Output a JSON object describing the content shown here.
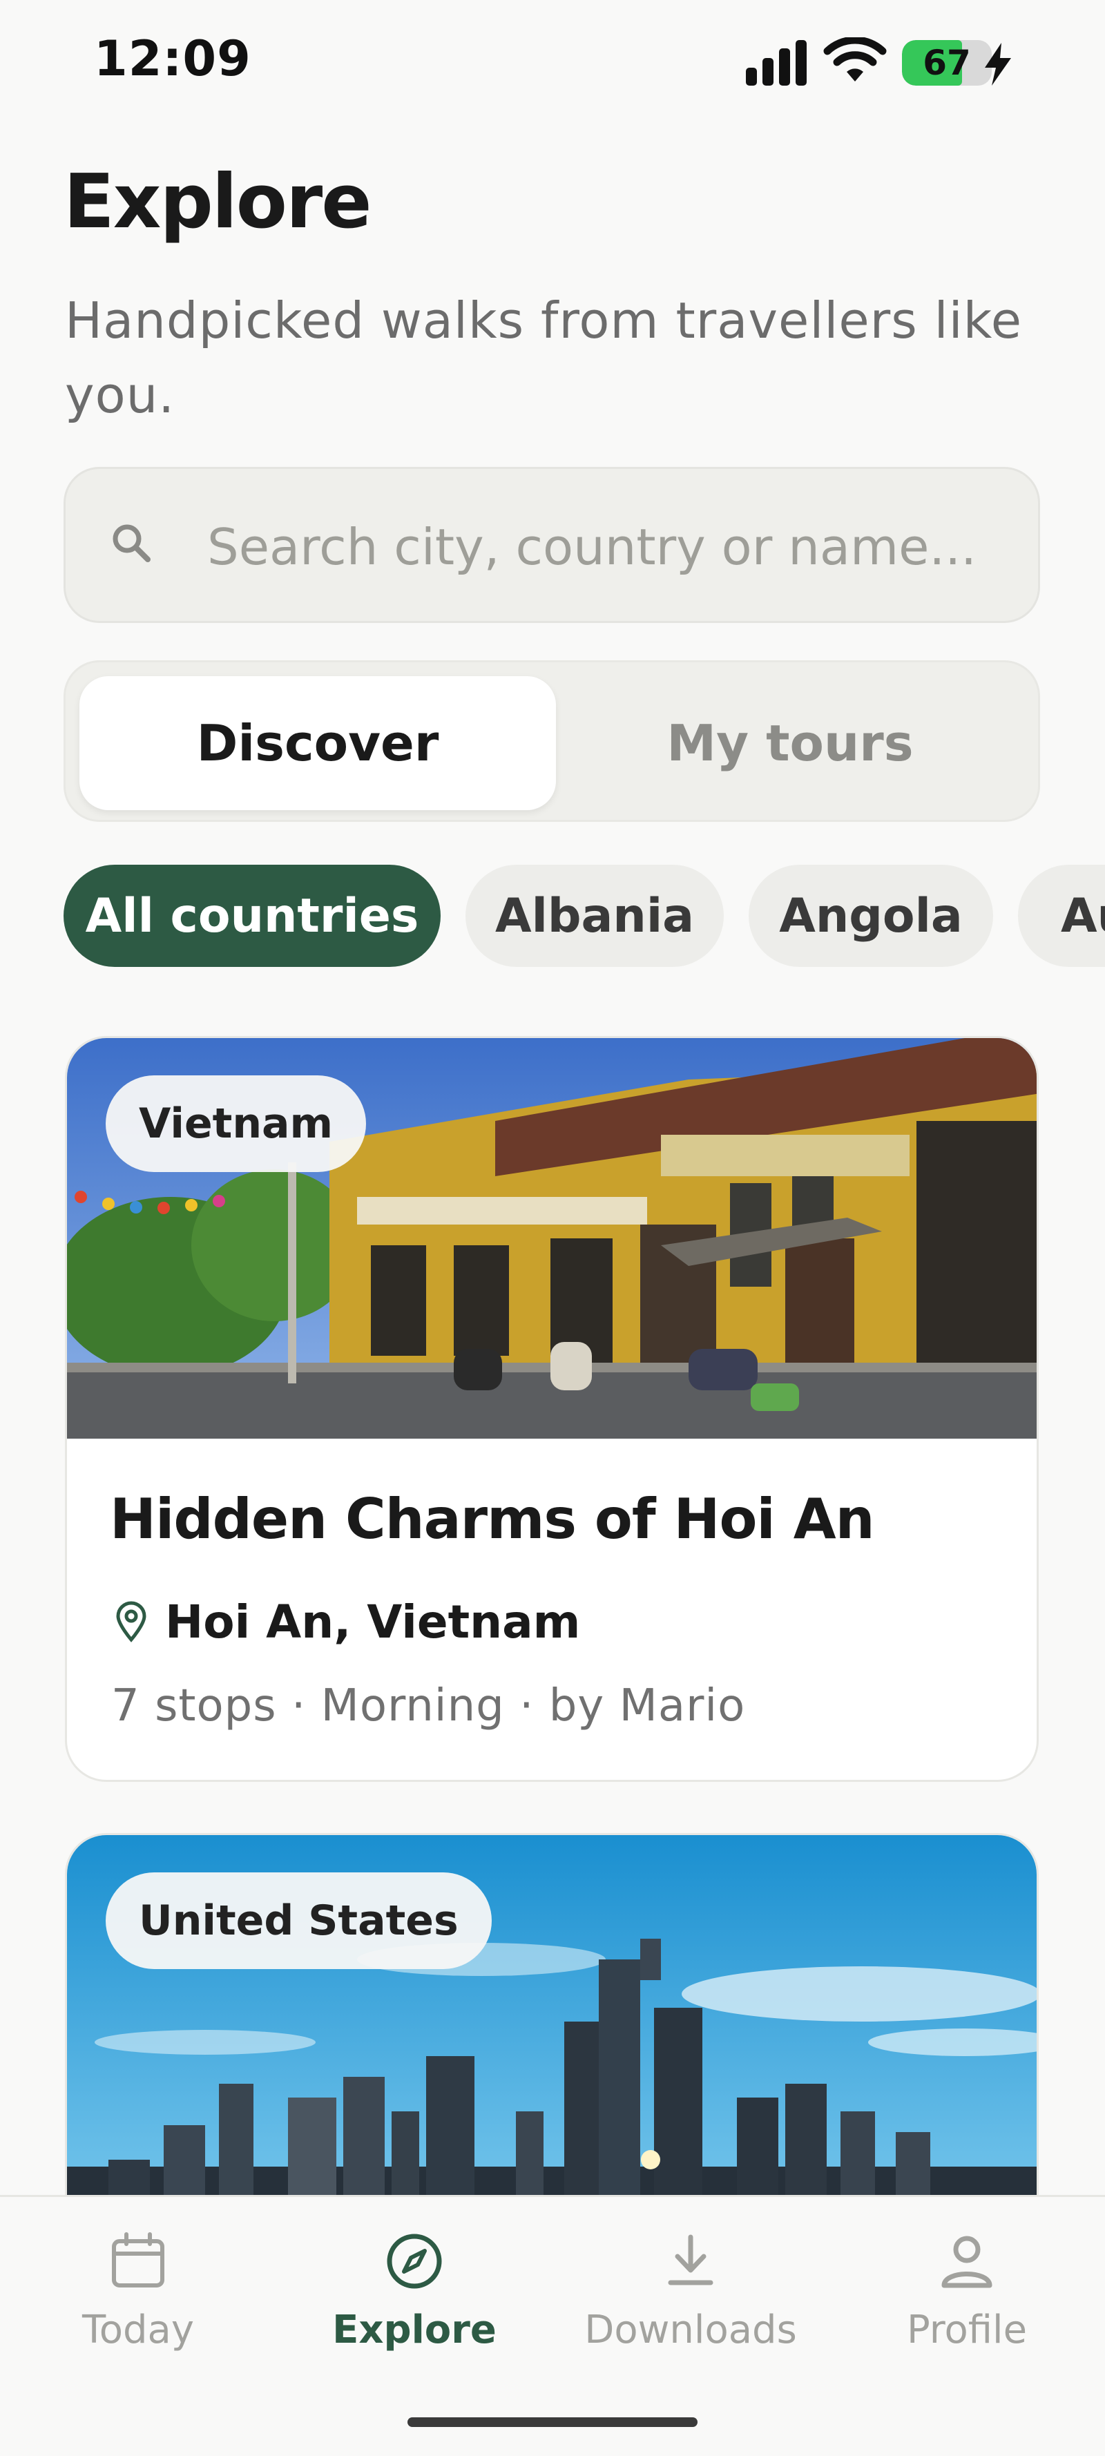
{
  "status_bar": {
    "time": "12:09",
    "battery_percent": 67,
    "battery_label": "67",
    "charging": true,
    "icons": [
      "signal-icon",
      "wifi-icon",
      "battery-icon",
      "bolt-icon"
    ]
  },
  "header": {
    "title": "Explore",
    "subtitle": "Handpicked walks from travellers like you."
  },
  "search": {
    "placeholder": "Search city, country or name...",
    "value": "",
    "icon": "search-icon"
  },
  "segments": {
    "options": [
      "Discover",
      "My tours"
    ],
    "selected": "Discover"
  },
  "filters": {
    "chips": [
      "All countries",
      "Albania",
      "Angola",
      "Au"
    ],
    "selected": "All countries"
  },
  "tours": [
    {
      "country": "Vietnam",
      "title": "Hidden Charms of Hoi An",
      "location": "Hoi An, Vietnam",
      "meta": "7 stops · Morning · by Mario"
    },
    {
      "country": "United States"
    }
  ],
  "bottom_nav": {
    "items": [
      {
        "label": "Today",
        "icon": "calendar-icon"
      },
      {
        "label": "Explore",
        "icon": "compass-icon"
      },
      {
        "label": "Downloads",
        "icon": "download-icon"
      },
      {
        "label": "Profile",
        "icon": "person-icon"
      }
    ],
    "active": "Explore"
  },
  "colors": {
    "accent": "#2d5a44",
    "background": "#f9f9f8",
    "muted_text": "#6c6c6c",
    "chip_bg": "#ededea"
  }
}
